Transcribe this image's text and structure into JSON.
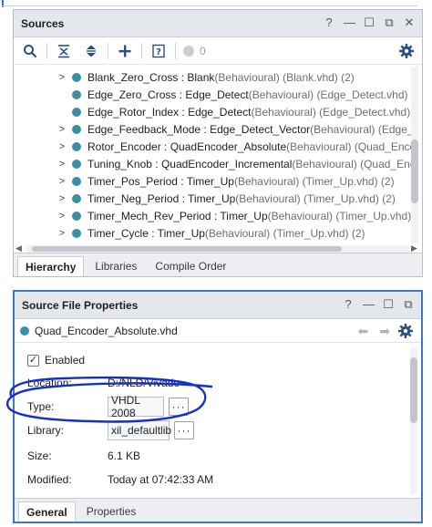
{
  "sources_panel": {
    "title": "Sources",
    "window_controls": [
      "?",
      "—",
      "☐",
      "⧉",
      "✕"
    ],
    "toolbar": {
      "badge_count": "0",
      "icons": [
        "search-icon",
        "collapse-all-icon",
        "expand-all-icon",
        "add-icon",
        "properties-icon",
        "status-dot-icon",
        "gear-icon"
      ]
    },
    "tree_rows": [
      {
        "expand": true,
        "name": "Blank_Zero_Cross : Blank",
        "meta": "(Behavioural) (Blank.vhd) (2)"
      },
      {
        "expand": false,
        "name": "Edge_Zero_Cross : Edge_Detect",
        "meta": "(Behavioural) (Edge_Detect.vhd)"
      },
      {
        "expand": false,
        "name": "Edge_Rotor_Index : Edge_Detect",
        "meta": "(Behavioural) (Edge_Detect.vhd)"
      },
      {
        "expand": true,
        "name": "Edge_Feedback_Mode : Edge_Detect_Vector",
        "meta": "(Behavioural) (Edge_Detect_"
      },
      {
        "expand": true,
        "name": "Rotor_Encoder : QuadEncoder_Absolute",
        "meta": "(Behavioural) (Quad_Encoder_Ab"
      },
      {
        "expand": true,
        "name": "Tuning_Knob : QuadEncoder_Incremental",
        "meta": "(Behavioural) (Quad_Encoder_I"
      },
      {
        "expand": true,
        "name": "Timer_Pos_Period : Timer_Up",
        "meta": "(Behavioural) (Timer_Up.vhd) (2)"
      },
      {
        "expand": true,
        "name": "Timer_Neg_Period : Timer_Up",
        "meta": "(Behavioural) (Timer_Up.vhd) (2)"
      },
      {
        "expand": true,
        "name": "Timer_Mech_Rev_Period : Timer_Up",
        "meta": "(Behavioural) (Timer_Up.vhd) (2)"
      },
      {
        "expand": true,
        "name": "Timer_Cycle : Timer_Up",
        "meta": "(Behavioural) (Timer_Up.vhd) (2)"
      }
    ],
    "tabs": [
      "Hierarchy",
      "Libraries",
      "Compile Order"
    ],
    "active_tab": "Hierarchy"
  },
  "properties_panel": {
    "title": "Source File Properties",
    "window_controls": [
      "?",
      "—",
      "☐",
      "⧉"
    ],
    "file_name": "Quad_Encoder_Absolute.vhd",
    "enabled_label": "Enabled",
    "enabled": true,
    "properties": {
      "location": {
        "label": "Location:",
        "value": "D:/NLD/Vivado"
      },
      "type": {
        "label": "Type:",
        "value": "VHDL 2008"
      },
      "library": {
        "label": "Library:",
        "value": "xil_defaultlib"
      },
      "size": {
        "label": "Size:",
        "value": "6.1 KB"
      },
      "modified": {
        "label": "Modified:",
        "value": "Today at 07:42:33 AM"
      }
    },
    "ellipsis": "···",
    "tabs": [
      "General",
      "Properties"
    ],
    "active_tab": "General"
  },
  "colors": {
    "accent_border": "#3e77c7",
    "file_dot": "#3d8ea3",
    "annotation_ink": "#1530c8"
  }
}
